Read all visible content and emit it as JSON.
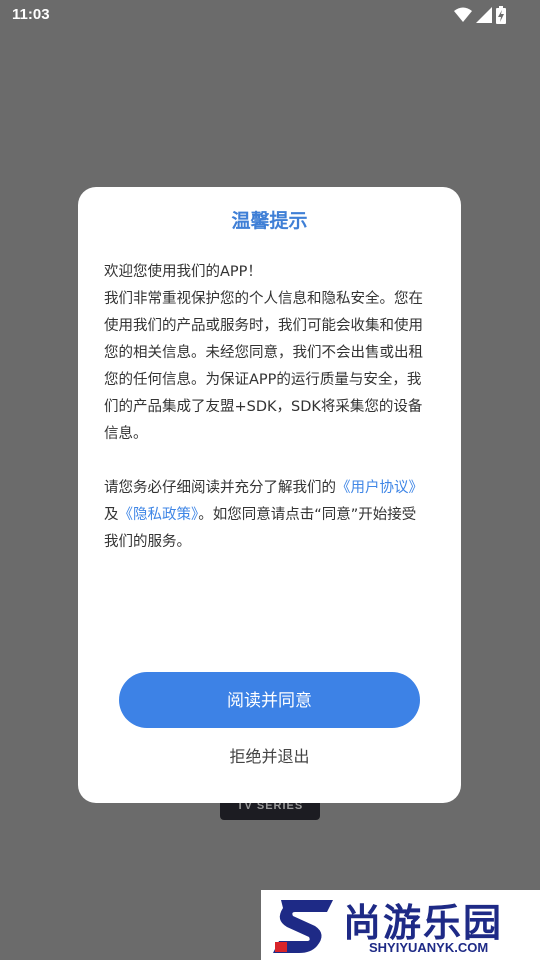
{
  "status_bar": {
    "time": "11:03",
    "icons": [
      "wifi-icon",
      "signal-icon",
      "battery-charging-icon"
    ]
  },
  "background": {
    "tag_text": "TV SERIES"
  },
  "dialog": {
    "title": "温馨提示",
    "paragraph1_lines": [
      "欢迎您使用我们的APP！",
      "我们非常重视保护您的个人信息和隐私安全。您在使用我们的产品或服务时，我们可能会收集和使用您的相关信息。未经您同意，我们不会出售或出租您的任何信息。为保证APP的运行质量与安全，我们的产品集成了友盟+SDK，SDK将采集您的设备信息。"
    ],
    "paragraph2": {
      "prefix": "请您务必仔细阅读并充分了解我们的",
      "link_agreement": "《用户协议》",
      "conjunction": "及",
      "link_privacy": "《隐私政策》",
      "suffix": "。如您同意请点击“同意”开始接受我们的服务。"
    },
    "primary_button": "阅读并同意",
    "secondary_button": "拒绝并退出"
  },
  "watermark": {
    "brand": "尚游乐园",
    "url": "SHYIYUANYK.COM"
  },
  "colors": {
    "accent": "#3d82e6",
    "title": "#3f7fd6",
    "overlay": "#6b6b6b",
    "watermark": "#1e2a86"
  }
}
